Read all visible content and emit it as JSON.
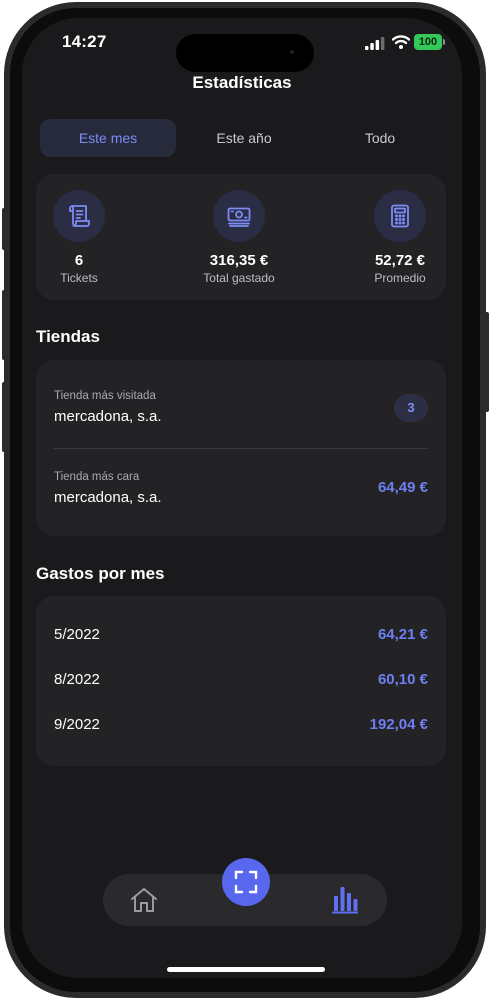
{
  "status_bar": {
    "time": "14:27",
    "battery": "100"
  },
  "header": {
    "title": "Estadísticas"
  },
  "period_tabs": [
    {
      "label": "Este mes",
      "active": true
    },
    {
      "label": "Este año",
      "active": false
    },
    {
      "label": "Todo",
      "active": false
    }
  ],
  "summary": [
    {
      "icon": "receipt-icon",
      "value": "6",
      "label": "Tickets"
    },
    {
      "icon": "banknote-icon",
      "value": "316,35 €",
      "label": "Total gastado"
    },
    {
      "icon": "calculator-icon",
      "value": "52,72 €",
      "label": "Promedio"
    }
  ],
  "stores": {
    "title": "Tiendas",
    "most_visited": {
      "caption": "Tienda más visitada",
      "name": "mercadona, s.a.",
      "count": "3"
    },
    "most_expensive": {
      "caption": "Tienda más cara",
      "name": "mercadona, s.a.",
      "amount": "64,49 €"
    }
  },
  "monthly": {
    "title": "Gastos por mes",
    "rows": [
      {
        "month": "5/2022",
        "amount": "64,21 €"
      },
      {
        "month": "8/2022",
        "amount": "60,10 €"
      },
      {
        "month": "9/2022",
        "amount": "192,04 €"
      }
    ]
  },
  "colors": {
    "accent": "#6f7ff2",
    "scan_button": "#5768ef",
    "background": "#1a1a1c",
    "card": "#232326"
  }
}
